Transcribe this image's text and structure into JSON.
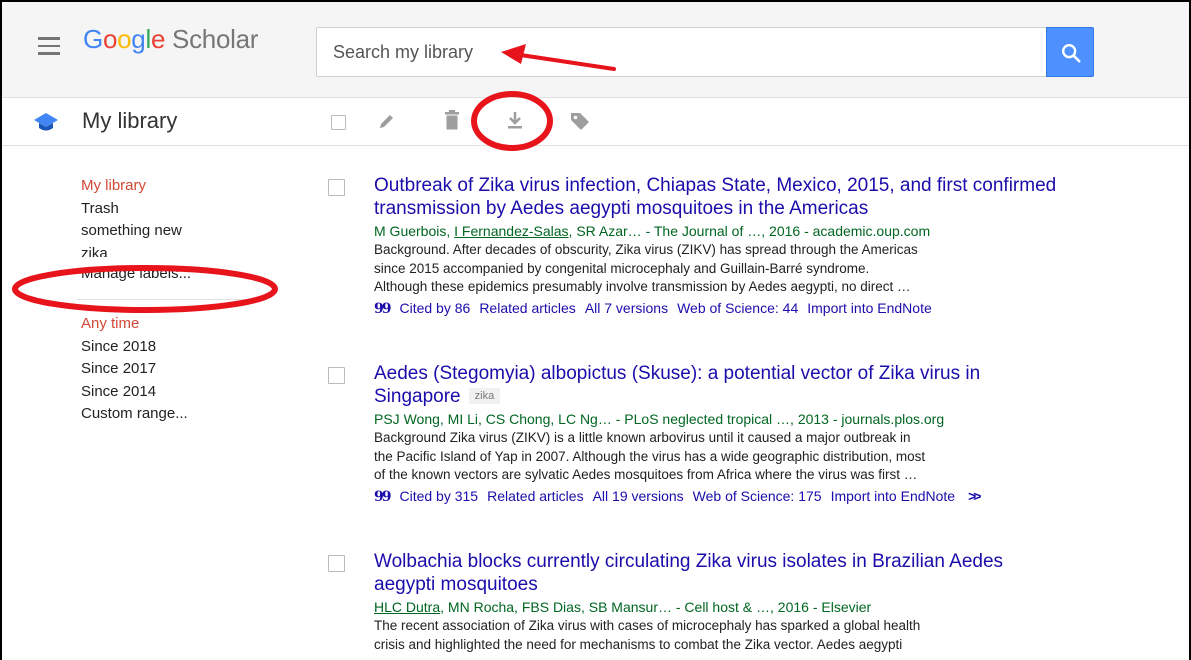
{
  "header": {
    "logo": {
      "google_letters": [
        "G",
        "o",
        "o",
        "g",
        "l",
        "e"
      ],
      "scholar": "Scholar"
    },
    "search": {
      "placeholder": "Search my library",
      "value": ""
    },
    "colors": {
      "search_button": "#4d90fe",
      "brand_blue": "#4285f4",
      "brand_red": "#ea4335",
      "brand_yellow": "#fbbc05",
      "brand_green": "#34a853"
    }
  },
  "toolbar": {
    "library_title": "My library",
    "icons": [
      "select-all-checkbox",
      "edit-icon",
      "trash-icon",
      "download-icon",
      "label-tag-icon"
    ]
  },
  "sidebar": {
    "labels": [
      {
        "label": "My library",
        "active": true
      },
      {
        "label": "Trash",
        "active": false
      },
      {
        "label": "something new",
        "active": false
      },
      {
        "label": "zika",
        "active": false
      },
      {
        "label": "Manage labels...",
        "active": false
      }
    ],
    "time_filters": [
      {
        "label": "Any time",
        "active": true
      },
      {
        "label": "Since 2018",
        "active": false
      },
      {
        "label": "Since 2017",
        "active": false
      },
      {
        "label": "Since 2014",
        "active": false
      },
      {
        "label": "Custom range...",
        "active": false
      }
    ],
    "active_color": "#d14836"
  },
  "results": [
    {
      "title_lines": [
        "Outbreak of Zika virus infection, Chiapas State, Mexico, 2015, and first confirmed",
        "transmission by Aedes aegypti mosquitoes in the Americas"
      ],
      "label": "",
      "authors_prefix": "M Guerbois, ",
      "authors_link": "I Fernandez-Salas",
      "authors_suffix": ", SR Azar… - The Journal of …, 2016 - academic.oup.com",
      "snippet_lines": [
        "Background. After decades of obscurity, Zika virus (ZIKV) has spread through the Americas",
        "since 2015 accompanied by congenital microcephaly and Guillain-Barré syndrome.",
        "Although these epidemics presumably involve transmission by Aedes aegypti, no direct …"
      ],
      "links": {
        "cited": "Cited by 86",
        "related": "Related articles",
        "versions": "All 7 versions",
        "wos": "Web of Science: 44",
        "import": "Import into EndNote"
      }
    },
    {
      "title_lines": [
        "Aedes (Stegomyia) albopictus (Skuse): a potential vector of Zika virus in",
        "Singapore"
      ],
      "label": "zika",
      "authors_prefix": "PSJ Wong, MI Li, CS Chong, LC Ng… - PLoS neglected tropical …, 2013 - journals.plos.org",
      "authors_link": "",
      "authors_suffix": "",
      "snippet_lines": [
        "Background Zika virus (ZIKV) is a little known arbovirus until it caused a major outbreak in",
        "the Pacific Island of Yap in 2007. Although the virus has a wide geographic distribution, most",
        "of the known vectors are sylvatic Aedes mosquitoes from Africa where the virus was first …"
      ],
      "links": {
        "cited": "Cited by 315",
        "related": "Related articles",
        "versions": "All 19 versions",
        "wos": "Web of Science: 175",
        "import": "Import into EndNote"
      }
    },
    {
      "title_lines": [
        "Wolbachia blocks currently circulating Zika virus isolates in Brazilian Aedes",
        "aegypti mosquitoes"
      ],
      "label": "",
      "authors_prefix": "",
      "authors_link": "HLC Dutra",
      "authors_suffix": ", MN Rocha, FBS Dias, SB Mansur… - Cell host & …, 2016 - Elsevier",
      "snippet_lines": [
        "The recent association of Zika virus with cases of microcephaly has sparked a global health",
        "crisis and highlighted the need for mechanisms to combat the Zika vector. Aedes aegypti"
      ],
      "links": null
    }
  ],
  "annotation_color": "#e8141b"
}
